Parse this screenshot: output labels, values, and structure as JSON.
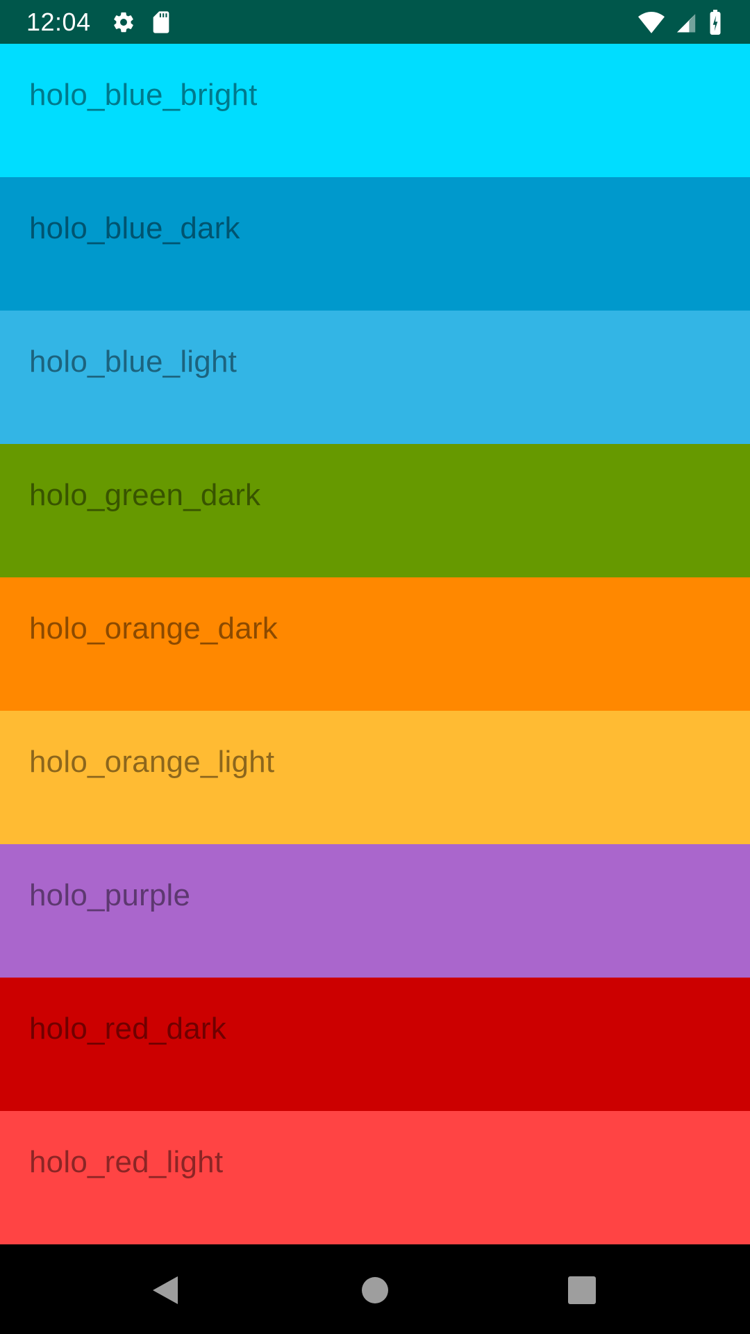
{
  "status_bar": {
    "time": "12:04",
    "background": "#00574B",
    "icons": [
      "gear-icon",
      "sd-card-icon",
      "wifi-icon",
      "cell-signal-icon",
      "battery-charging-icon"
    ]
  },
  "colors": [
    {
      "name": "holo_blue_bright",
      "hex": "#00DDFF"
    },
    {
      "name": "holo_blue_dark",
      "hex": "#0099CC"
    },
    {
      "name": "holo_blue_light",
      "hex": "#33B5E5"
    },
    {
      "name": "holo_green_dark",
      "hex": "#669900"
    },
    {
      "name": "holo_orange_dark",
      "hex": "#FF8800"
    },
    {
      "name": "holo_orange_light",
      "hex": "#FFBB33"
    },
    {
      "name": "holo_purple",
      "hex": "#AA66CC"
    },
    {
      "name": "holo_red_dark",
      "hex": "#CC0000"
    },
    {
      "name": "holo_red_light",
      "hex": "#FF4444"
    }
  ],
  "nav_bar": {
    "background": "#000000",
    "icons": [
      "back-icon",
      "home-icon",
      "recents-icon"
    ],
    "icon_color": "#9E9E9E"
  }
}
